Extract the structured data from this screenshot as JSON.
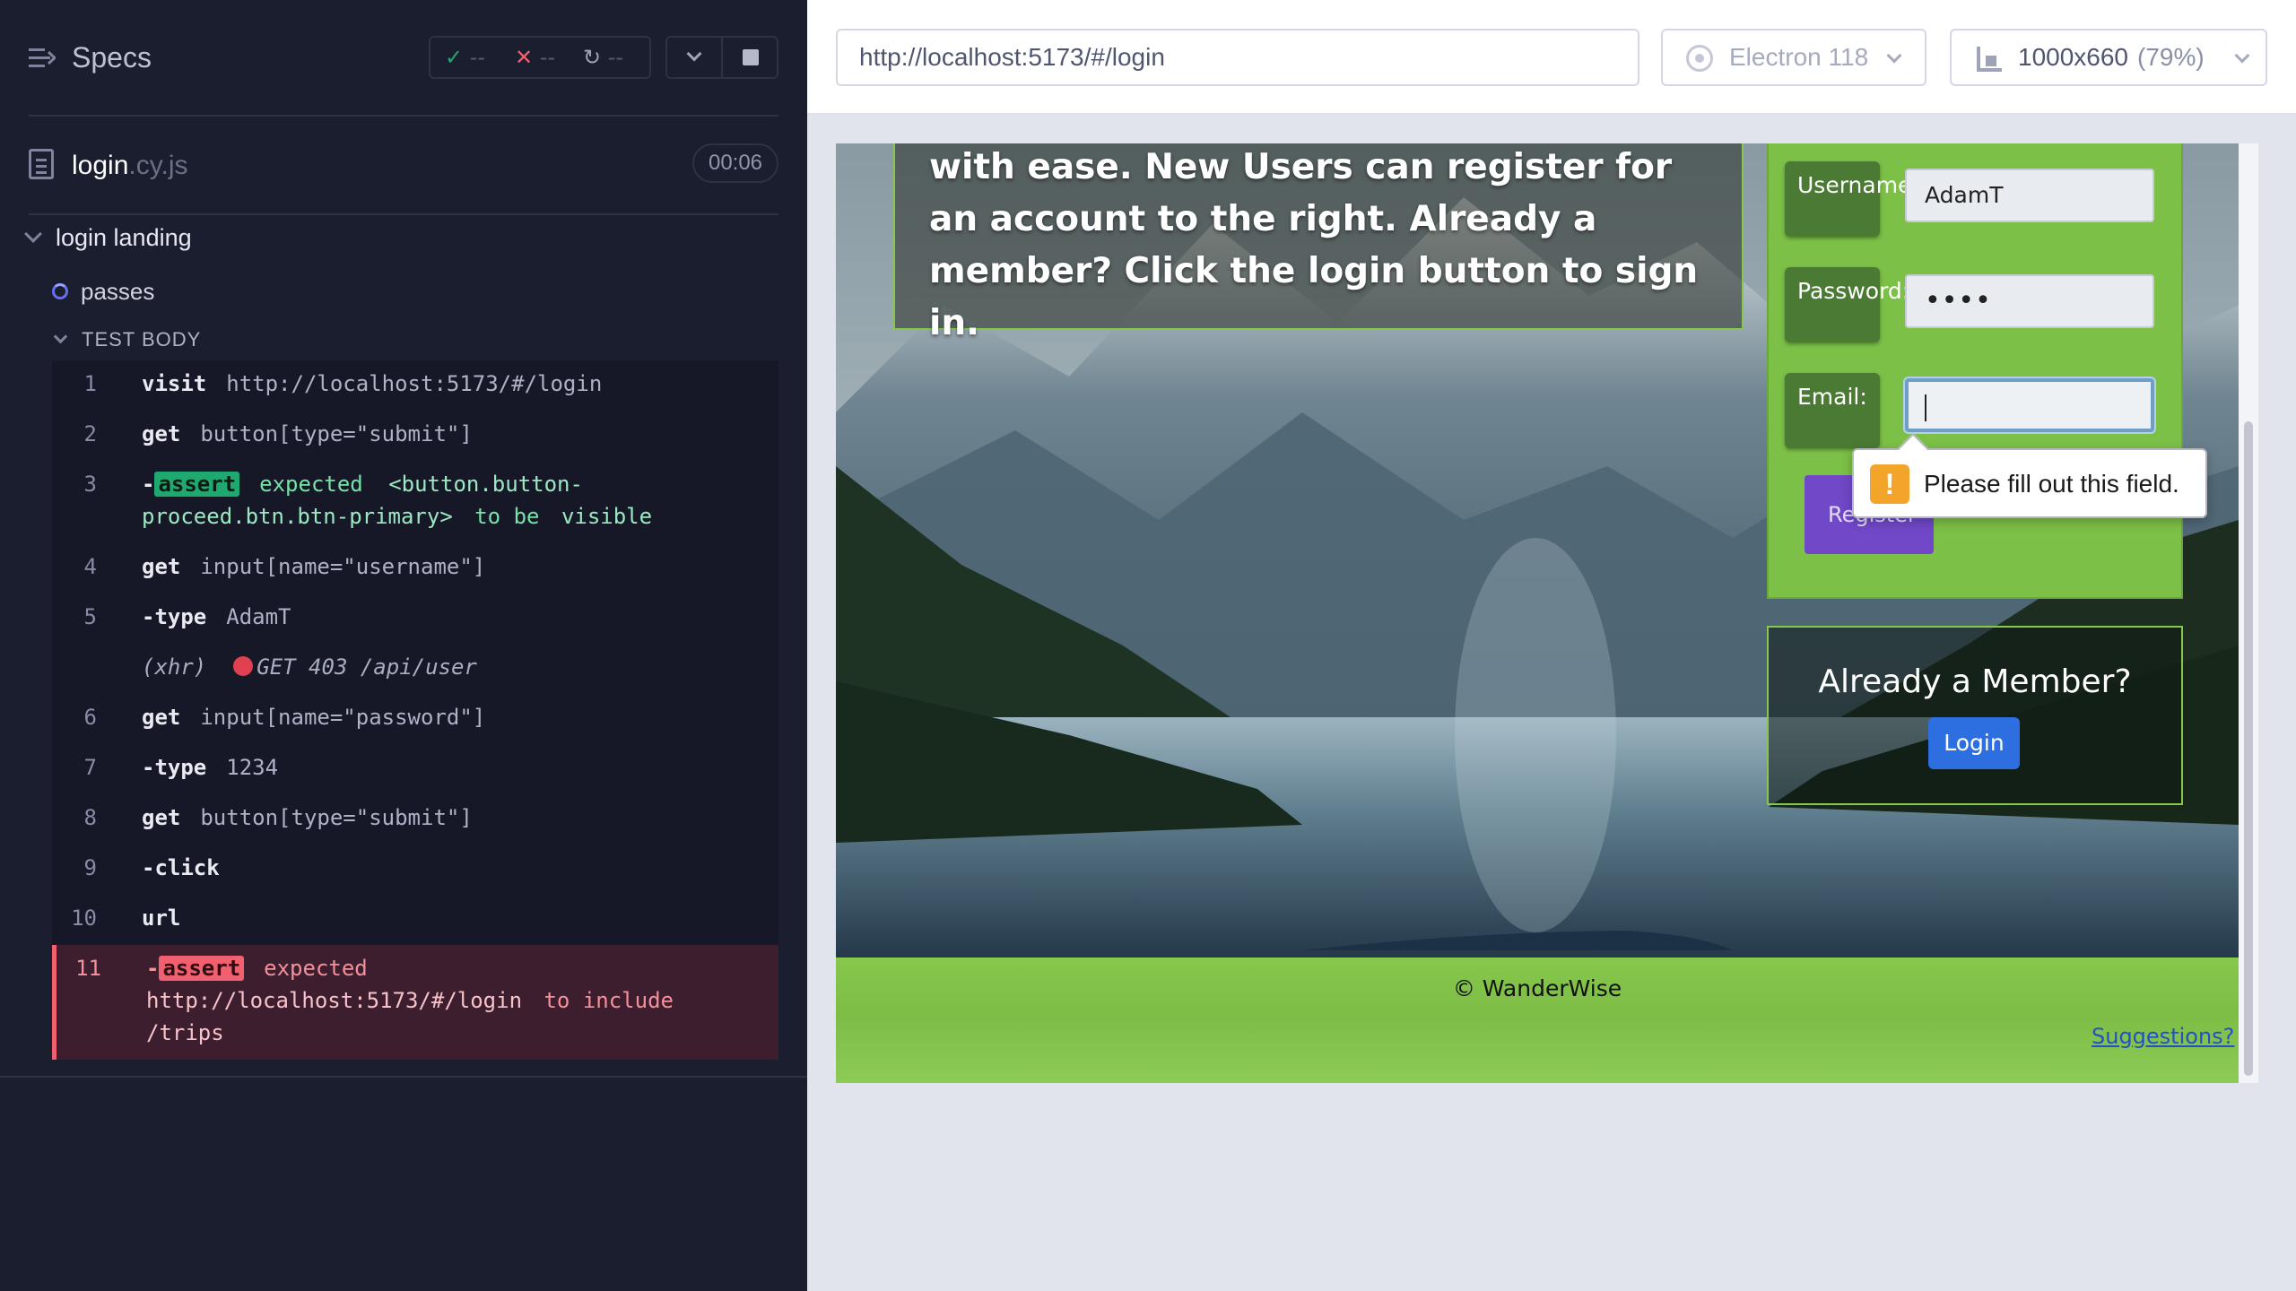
{
  "reporter": {
    "title": "Specs",
    "stats": {
      "passed": "--",
      "failed": "--",
      "pending": "--"
    },
    "file": {
      "name": "login",
      "ext": ".cy.js",
      "duration": "00:06"
    },
    "suite": "login landing",
    "test": "passes",
    "section": "TEST BODY",
    "commands": [
      {
        "num": "1",
        "name": "visit",
        "arg": "http://localhost:5173/#/login"
      },
      {
        "num": "2",
        "name": "get",
        "arg": "button[type=\"submit\"]"
      },
      {
        "num": "3",
        "prefix": "-",
        "tag": "assert",
        "word1": "expected",
        "subject": "<button.button-proceed.btn.btn-primary>",
        "word2": "to be",
        "word3": "visible"
      },
      {
        "num": "4",
        "name": "get",
        "arg": "input[name=\"username\"]"
      },
      {
        "num": "5",
        "name": "-type",
        "arg": "AdamT"
      },
      {
        "xhr": "(xhr)",
        "xhr_text": "GET 403 /api/user"
      },
      {
        "num": "6",
        "name": "get",
        "arg": "input[name=\"password\"]"
      },
      {
        "num": "7",
        "name": "-type",
        "arg": "1234"
      },
      {
        "num": "8",
        "name": "get",
        "arg": "button[type=\"submit\"]"
      },
      {
        "num": "9",
        "name": "-click",
        "arg": ""
      },
      {
        "num": "10",
        "name": "url",
        "arg": ""
      },
      {
        "num": "11",
        "prefix": "-",
        "tag": "assert",
        "word1": "expected",
        "subject": "http://localhost:5173/#/login",
        "word2": "to include",
        "word3": "/trips"
      }
    ]
  },
  "topbar": {
    "url": "http://localhost:5173/#/login",
    "browser": "Electron 118",
    "viewport": "1000x660",
    "zoom": "(79%)"
  },
  "app": {
    "hero_text": "with ease. New Users can register for an account to the right. Already a member? Click the login button to sign in.",
    "labels": {
      "username": "Username:",
      "password": "Password:",
      "email": "Email:"
    },
    "values": {
      "username": "AdamT",
      "password": "••••",
      "email": ""
    },
    "register": "Register",
    "tooltip": "Please fill out this field.",
    "member_title": "Already a Member?",
    "login": "Login",
    "footer": "© WanderWise",
    "suggestions": "Suggestions?"
  },
  "colors": {
    "reporter_bg": "#1b1e2e",
    "pass": "#1fa971",
    "fail": "#f1606f",
    "app_green": "#7cc047",
    "login_blue": "#2d6fe0",
    "register_purple": "#7048c8"
  },
  "icons": [
    "specs-icon",
    "check-icon",
    "x-icon",
    "pending-icon",
    "chevron-down-icon",
    "stop-icon",
    "file-icon",
    "electron-icon",
    "viewport-icon",
    "warning-icon"
  ]
}
